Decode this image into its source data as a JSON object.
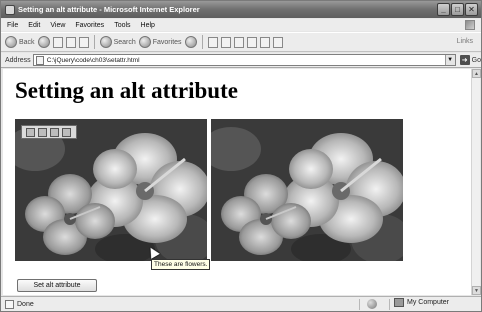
{
  "window": {
    "title": "Setting an alt attribute - Microsoft Internet Explorer"
  },
  "menu": {
    "items": [
      "File",
      "Edit",
      "View",
      "Favorites",
      "Tools",
      "Help"
    ]
  },
  "toolbar": {
    "back_label": "Back",
    "search_label": "Search",
    "favorites_label": "Favorites",
    "links_label": "Links",
    "icons": [
      "back-icon",
      "forward-icon",
      "stop-icon",
      "refresh-icon",
      "home-icon",
      "search-icon",
      "favorites-icon",
      "media-icon",
      "history-icon",
      "mail-icon",
      "print-icon",
      "edit-icon",
      "discuss-icon",
      "messenger-icon"
    ]
  },
  "address": {
    "label": "Address",
    "value": "C:\\jQuery\\code\\ch03\\setattr.html",
    "go_label": "Go"
  },
  "page": {
    "heading": "Setting an alt attribute",
    "tooltip": "These are flowers.",
    "button_label": "Set alt attribute",
    "images": [
      "hibiscus-photo",
      "hibiscus-photo"
    ]
  },
  "status": {
    "text": "Done",
    "zone": "My Computer"
  }
}
